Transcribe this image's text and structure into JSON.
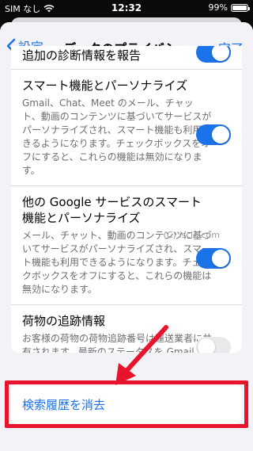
{
  "status_bar": {
    "carrier": "SIM なし",
    "time": "12:32",
    "battery": "99%"
  },
  "nav": {
    "back_label": "設定",
    "title": "データのプライバシー",
    "done_label": "完了"
  },
  "rows": [
    {
      "title": "追加の診断情報を報告",
      "description": "",
      "toggle": "on"
    },
    {
      "title": "スマート機能とパーソナライズ",
      "description": "Gmail、Chat、Meet のメール、チャット、動画のコンテンツに基づいてサービスがパーソナライズされ、スマート機能も利用できるようになります。チェックボックスをオフにすると、これらの機能は無効になります。",
      "toggle": "on"
    },
    {
      "title": "他の Google サービスのスマート機能とパーソナライズ",
      "description": "メール、チャット、動画のコンテンツに基づいてサービスがパーソナライズされ、スマート機能も利用できるようになります。チェックボックスをオフにすると、これらの機能は無効になります。",
      "toggle": "on"
    },
    {
      "title": "荷物の追跡情報",
      "description": "お客様の荷物の荷物追跡番号は運送業者に共有されます。最新のステータスを Gmail で確認できます。",
      "toggle": "off"
    }
  ],
  "watermark": "(C) iscle.com",
  "clear_history": {
    "label": "検索履歴を消去"
  },
  "colors": {
    "accent": "#1a73e8",
    "annotation": "#e8132d",
    "background": "#f2f2f7"
  }
}
